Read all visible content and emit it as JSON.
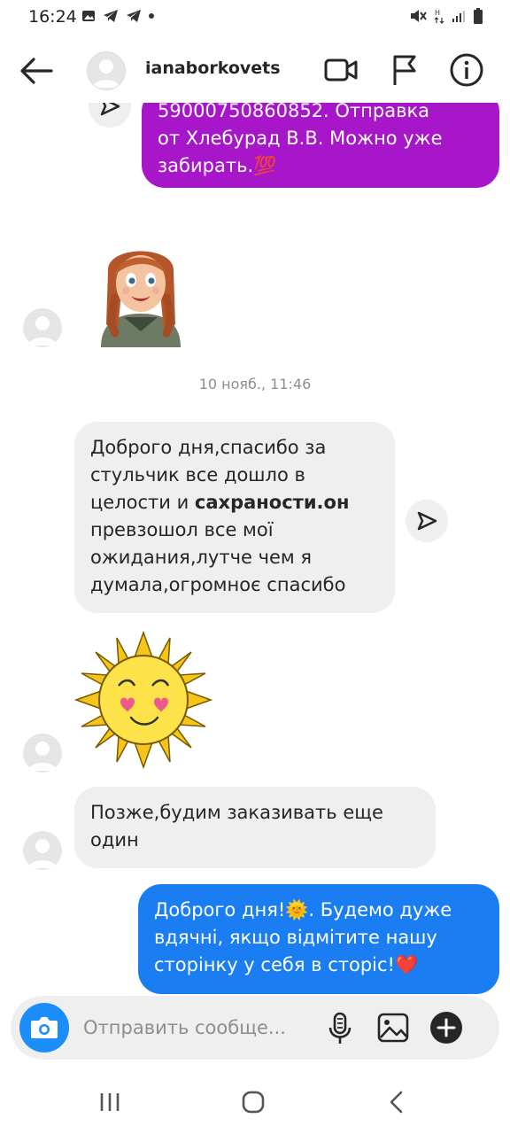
{
  "status_bar": {
    "time": "16:24"
  },
  "header": {
    "username": "ianaborkovets"
  },
  "messages": {
    "partial_sent": "59000750860852. Отправка от Хлебурад В.В. Можно уже забирать.💯",
    "partial_line1": "59000750860852. Отправка",
    "partial_line2": "от Хлебурад В.В. Можно уже",
    "partial_line3": "забирать.💯",
    "timestamp": "10 нояб., 11:46",
    "recv1": {
      "line1": "Доброго дня,спасибо за",
      "line2": "стульчик все дошло в",
      "line3_a": "целости и ",
      "line3_b": "сахраности.он",
      "line4": "превзошол все мої",
      "line5": "ожидания,лутче чем я",
      "line6": "думала,огромноє спасибо"
    },
    "recv2": {
      "line1": "Позже,будим заказивать еще",
      "line2": "один"
    },
    "sent1": {
      "line1": "Доброго дня!🌞. Будемо дуже",
      "line2": "вдячні, якщо відмітите нашу",
      "line3": "сторінку у себя в сторіс!❤️"
    }
  },
  "composer": {
    "placeholder": "Отправить сообще..."
  },
  "colors": {
    "sent_bubble_top": "#b41ad1",
    "sent_bubble_blue": "#1a7ef2",
    "received_bubble": "#efefef",
    "accent": "#1c8ef9"
  },
  "icons": {
    "back": "arrow-left-icon",
    "video": "video-camera-icon",
    "flag": "flag-icon",
    "info": "info-icon",
    "camera": "camera-icon",
    "mic": "microphone-icon",
    "gallery": "image-icon",
    "plus": "plus-circle-icon",
    "forward": "send-arrow-icon",
    "nav_recents": "recents-icon",
    "nav_home": "home-icon",
    "nav_back": "back-chevron-icon"
  }
}
